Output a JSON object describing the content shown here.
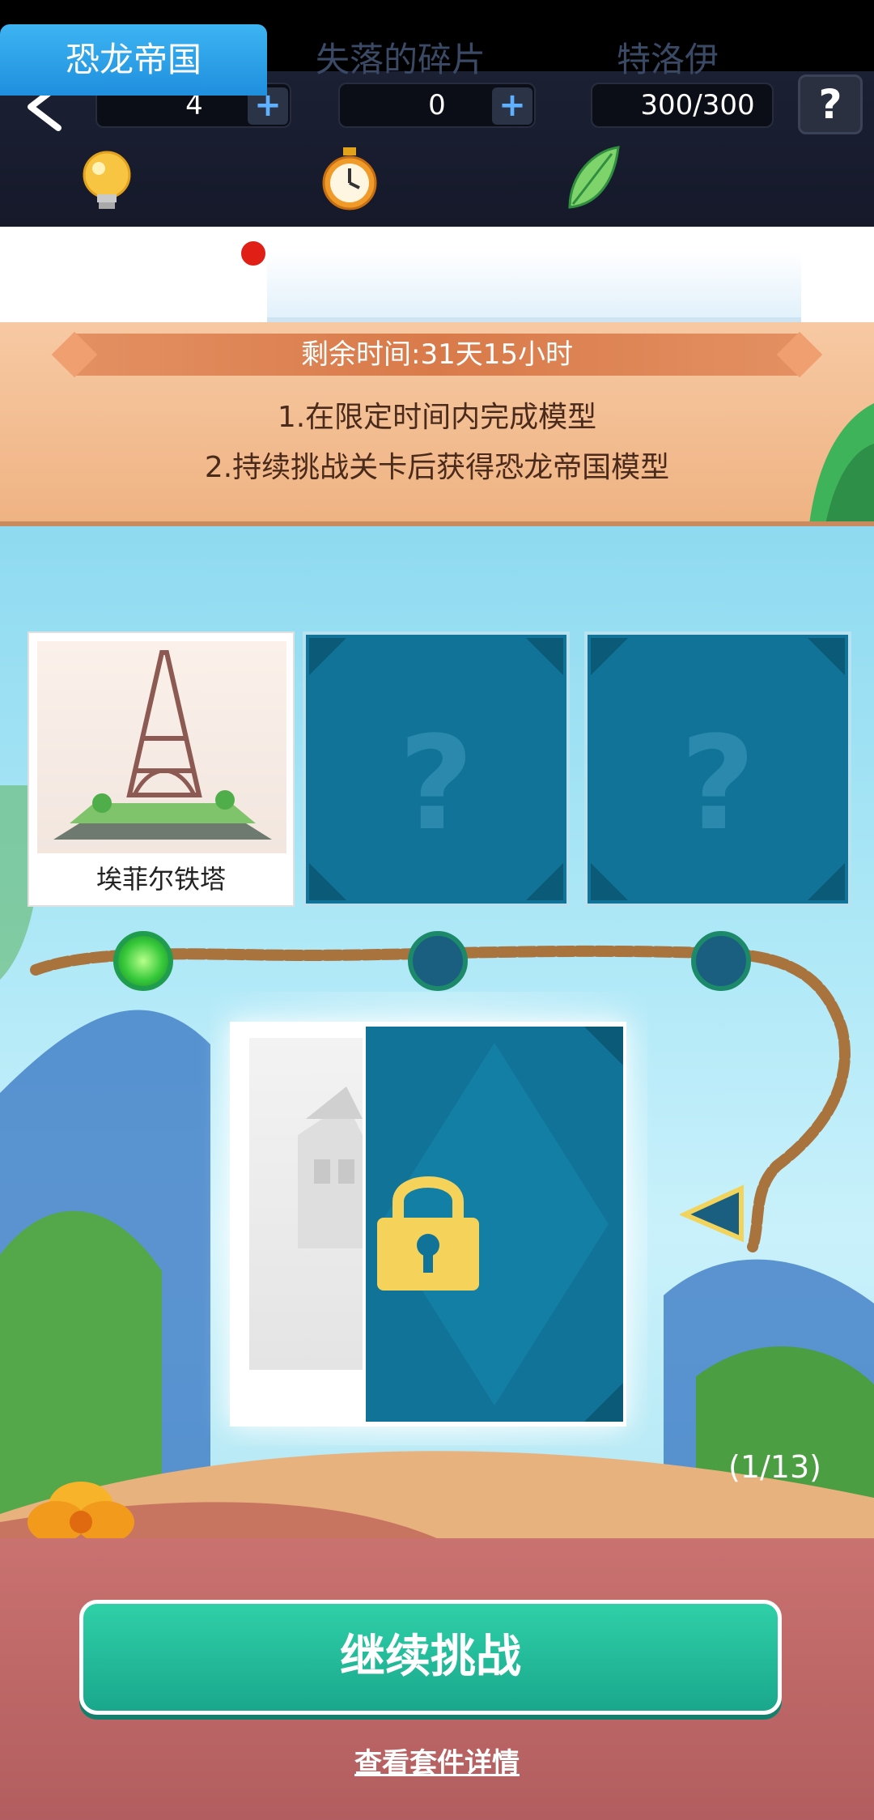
{
  "resources": {
    "hints": "4",
    "timers": "0",
    "energy": "300/300"
  },
  "help_label": "?",
  "tabs": [
    {
      "label": "恐龙帝国",
      "active": true,
      "has_notification": true
    },
    {
      "label": "失落的碎片",
      "active": false
    },
    {
      "label": "特洛伊",
      "active": false
    }
  ],
  "event": {
    "remaining_time": "剩余时间:31天15小时",
    "rules": [
      "1.在限定时间内完成模型",
      "2.持续挑战关卡后获得恐龙帝国模型"
    ]
  },
  "models": [
    {
      "name": "埃菲尔铁塔",
      "unlocked": true
    },
    {
      "name": "?",
      "unlocked": false
    },
    {
      "name": "?",
      "unlocked": false
    }
  ],
  "current_level": {
    "locked": true
  },
  "progress": "(1/13)",
  "buttons": {
    "continue": "继续挑战",
    "view_details": "查看套件详情"
  },
  "colors": {
    "accent_teal": "#1aa78c",
    "tab_active": "#1f8fde",
    "card_locked": "#117397",
    "notification": "#e01f16"
  }
}
